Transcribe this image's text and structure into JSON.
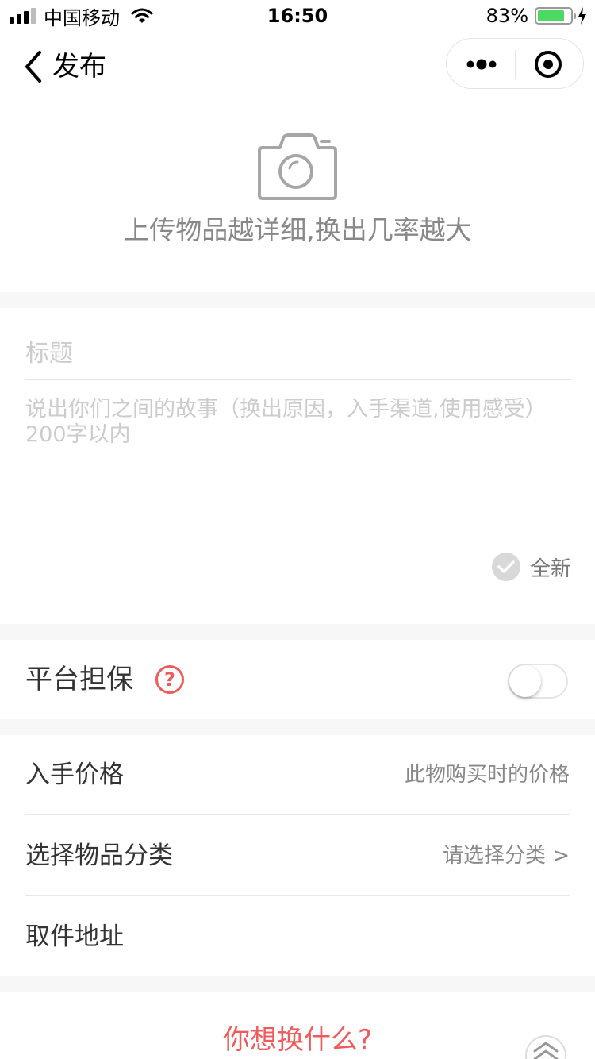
{
  "status_bar": {
    "carrier": "中国移动",
    "time": "16:50",
    "battery": "83%",
    "battery_level": 0.83,
    "signal_icon": "signal-icon",
    "wifi_icon": "wifi-icon",
    "charging_icon": "bolt-icon"
  },
  "nav": {
    "title": "发布",
    "back_icon": "chevron-left-icon",
    "more_icon": "more-dots-icon",
    "close_icon": "target-icon"
  },
  "upload": {
    "icon": "camera-icon",
    "hint": "上传物品越详细,换出几率越大"
  },
  "form": {
    "title_placeholder": "标题",
    "story_placeholder": "说出你们之间的故事（换出原因，入手渠道,使用感受）200字以内",
    "new_label": "全新",
    "new_checked": false
  },
  "guarantee": {
    "label": "平台担保",
    "help_icon": "question-icon",
    "help_glyph": "?",
    "enabled": false
  },
  "details": {
    "price_label": "入手价格",
    "price_placeholder": "此物购买时的价格",
    "category_label": "选择物品分类",
    "category_value": "请选择分类 >",
    "address_label": "取件地址"
  },
  "footer": {
    "want_label": "你想换什么?",
    "top_icon": "chevron-up-icon"
  },
  "colors": {
    "accent": "#f05a5a",
    "battery": "#4cd964",
    "placeholder": "#cccccc",
    "background": "#f7f7f7"
  }
}
